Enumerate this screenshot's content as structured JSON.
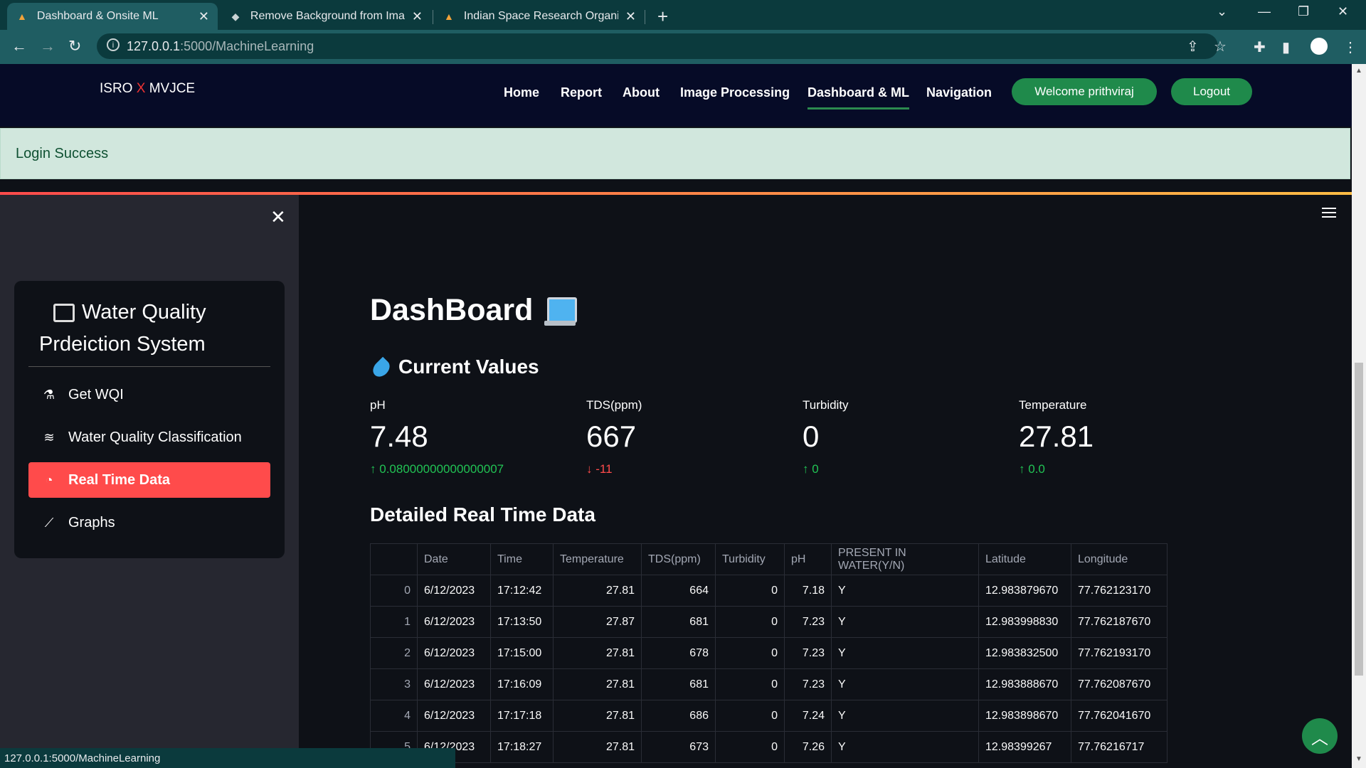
{
  "browser": {
    "tabs": [
      {
        "title": "Dashboard & Onsite ML"
      },
      {
        "title": "Remove Background from Image"
      },
      {
        "title": "Indian Space Research Organisati"
      }
    ],
    "url_host": "127.0.0.1",
    "url_path": ":5000/MachineLearning",
    "status_url": "127.0.0.1:5000/MachineLearning"
  },
  "site_nav": {
    "brand_left": "ISRO",
    "brand_x": "X",
    "brand_right": "MVJCE",
    "links": [
      "Home",
      "Report",
      "About",
      "Image Processing",
      "Dashboard & ML",
      "Navigation"
    ],
    "welcome": "Welcome prithviraj",
    "logout": "Logout"
  },
  "alert": "Login Success",
  "sidebar": {
    "title": "Water Quality Prdeiction System",
    "items": [
      {
        "label": "Get WQI",
        "icon": "flask-icon"
      },
      {
        "label": "Water Quality Classification",
        "icon": "water-icon"
      },
      {
        "label": "Real Time Data",
        "icon": "speedometer-icon"
      },
      {
        "label": "Graphs",
        "icon": "line-chart-icon"
      }
    ],
    "active_color": "#ff4b4b"
  },
  "main": {
    "title": "DashBoard",
    "current_values_title": "Current Values",
    "metrics": [
      {
        "label": "pH",
        "value": "7.48",
        "delta": "0.08000000000000007",
        "direction": "up"
      },
      {
        "label": "TDS(ppm)",
        "value": "667",
        "delta": "-11",
        "direction": "down"
      },
      {
        "label": "Turbidity",
        "value": "0",
        "delta": "0",
        "direction": "up"
      },
      {
        "label": "Temperature",
        "value": "27.81",
        "delta": "0.0",
        "direction": "up"
      }
    ],
    "detail_title": "Detailed Real Time Data",
    "table": {
      "columns": [
        "",
        "Date",
        "Time",
        "Temperature",
        "TDS(ppm)",
        "Turbidity",
        "pH",
        "PRESENT IN WATER(Y/N)",
        "Latitude",
        "Longitude"
      ],
      "rows": [
        [
          "0",
          "6/12/2023",
          "17:12:42",
          "27.81",
          "664",
          "0",
          "7.18",
          "Y",
          "12.983879670",
          "77.762123170"
        ],
        [
          "1",
          "6/12/2023",
          "17:13:50",
          "27.87",
          "681",
          "0",
          "7.23",
          "Y",
          "12.983998830",
          "77.762187670"
        ],
        [
          "2",
          "6/12/2023",
          "17:15:00",
          "27.81",
          "678",
          "0",
          "7.23",
          "Y",
          "12.983832500",
          "77.762193170"
        ],
        [
          "3",
          "6/12/2023",
          "17:16:09",
          "27.81",
          "681",
          "0",
          "7.23",
          "Y",
          "12.983888670",
          "77.762087670"
        ],
        [
          "4",
          "6/12/2023",
          "17:17:18",
          "27.81",
          "686",
          "0",
          "7.24",
          "Y",
          "12.983898670",
          "77.762041670"
        ],
        [
          "5",
          "6/12/2023",
          "17:18:27",
          "27.81",
          "673",
          "0",
          "7.26",
          "Y",
          "12.98399267",
          "77.76216717"
        ]
      ]
    }
  },
  "colors": {
    "accent_green": "#1f8a4b",
    "up": "#21c354",
    "down": "#ff4b4b"
  }
}
